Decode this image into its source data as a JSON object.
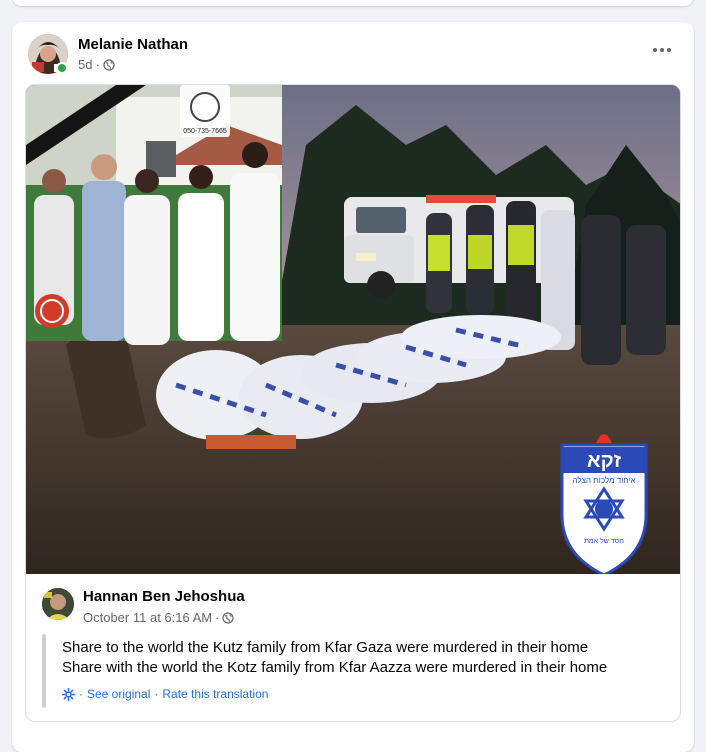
{
  "post": {
    "author": "Melanie Nathan",
    "time": "5d",
    "separator": "·",
    "privacy_icon": "globe-icon",
    "more_icon": "more-horizontal-icon",
    "photo": {
      "sign_phone": "050-735-7665",
      "logo_text": "זקא",
      "logo_subtext": "איחוד מלכות הצלה",
      "logo_footer": "חסד של אמת"
    },
    "shared": {
      "author": "Hannan Ben Jehoshua",
      "time": "October 11 at 6:16 AM",
      "separator": "·",
      "lines": [
        "Share to the world the Kutz family from Kfar Gaza were murdered in their home",
        "Share with the world the Kotz family from Kfar Aazza were murdered in their home"
      ],
      "see_original": "See original",
      "rate_translation": "Rate this translation",
      "link_separator": "·"
    }
  },
  "colors": {
    "link": "#216fdb",
    "online": "#31a24c",
    "secondary_text": "#65676b"
  }
}
